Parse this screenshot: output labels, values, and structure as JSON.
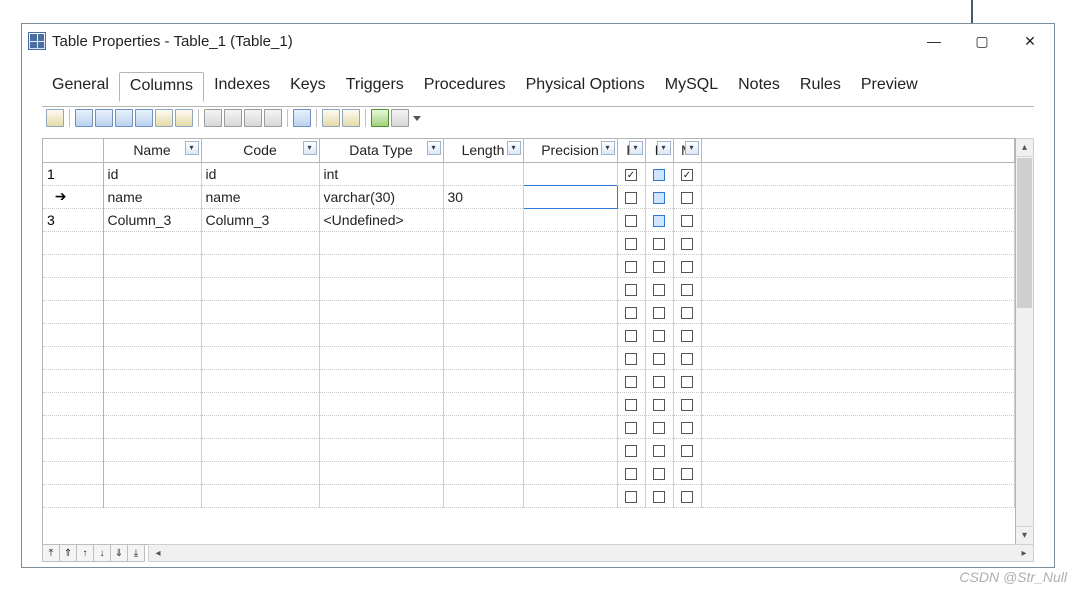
{
  "window": {
    "title": "Table Properties - Table_1 (Table_1)"
  },
  "tabs": [
    {
      "label": "General",
      "active": false
    },
    {
      "label": "Columns",
      "active": true
    },
    {
      "label": "Indexes",
      "active": false
    },
    {
      "label": "Keys",
      "active": false
    },
    {
      "label": "Triggers",
      "active": false
    },
    {
      "label": "Procedures",
      "active": false
    },
    {
      "label": "Physical Options",
      "active": false
    },
    {
      "label": "MySQL",
      "active": false
    },
    {
      "label": "Notes",
      "active": false
    },
    {
      "label": "Rules",
      "active": false
    },
    {
      "label": "Preview",
      "active": false
    }
  ],
  "grid": {
    "headers": {
      "name": "Name",
      "code": "Code",
      "datatype": "Data Type",
      "length": "Length",
      "precision": "Precision",
      "p": "P",
      "f": "F",
      "m": "M"
    },
    "rows": [
      {
        "rownum": "1",
        "arrow": false,
        "name": "id",
        "code": "id",
        "datatype": "int",
        "length": "",
        "precision": "",
        "p": true,
        "f": false,
        "f_blue": true,
        "m": true,
        "editing": false
      },
      {
        "rownum": "",
        "arrow": true,
        "name": "name",
        "code": "name",
        "datatype": "varchar(30)",
        "length": "30",
        "precision": "",
        "p": false,
        "f": false,
        "f_blue": true,
        "m": false,
        "editing": true
      },
      {
        "rownum": "3",
        "arrow": false,
        "name": "Column_3",
        "code": "Column_3",
        "datatype": "<Undefined>",
        "length": "",
        "precision": "",
        "p": false,
        "f": false,
        "f_blue": true,
        "m": false,
        "editing": false
      }
    ],
    "empty_rows": 12
  },
  "watermark": "CSDN @Str_Null"
}
